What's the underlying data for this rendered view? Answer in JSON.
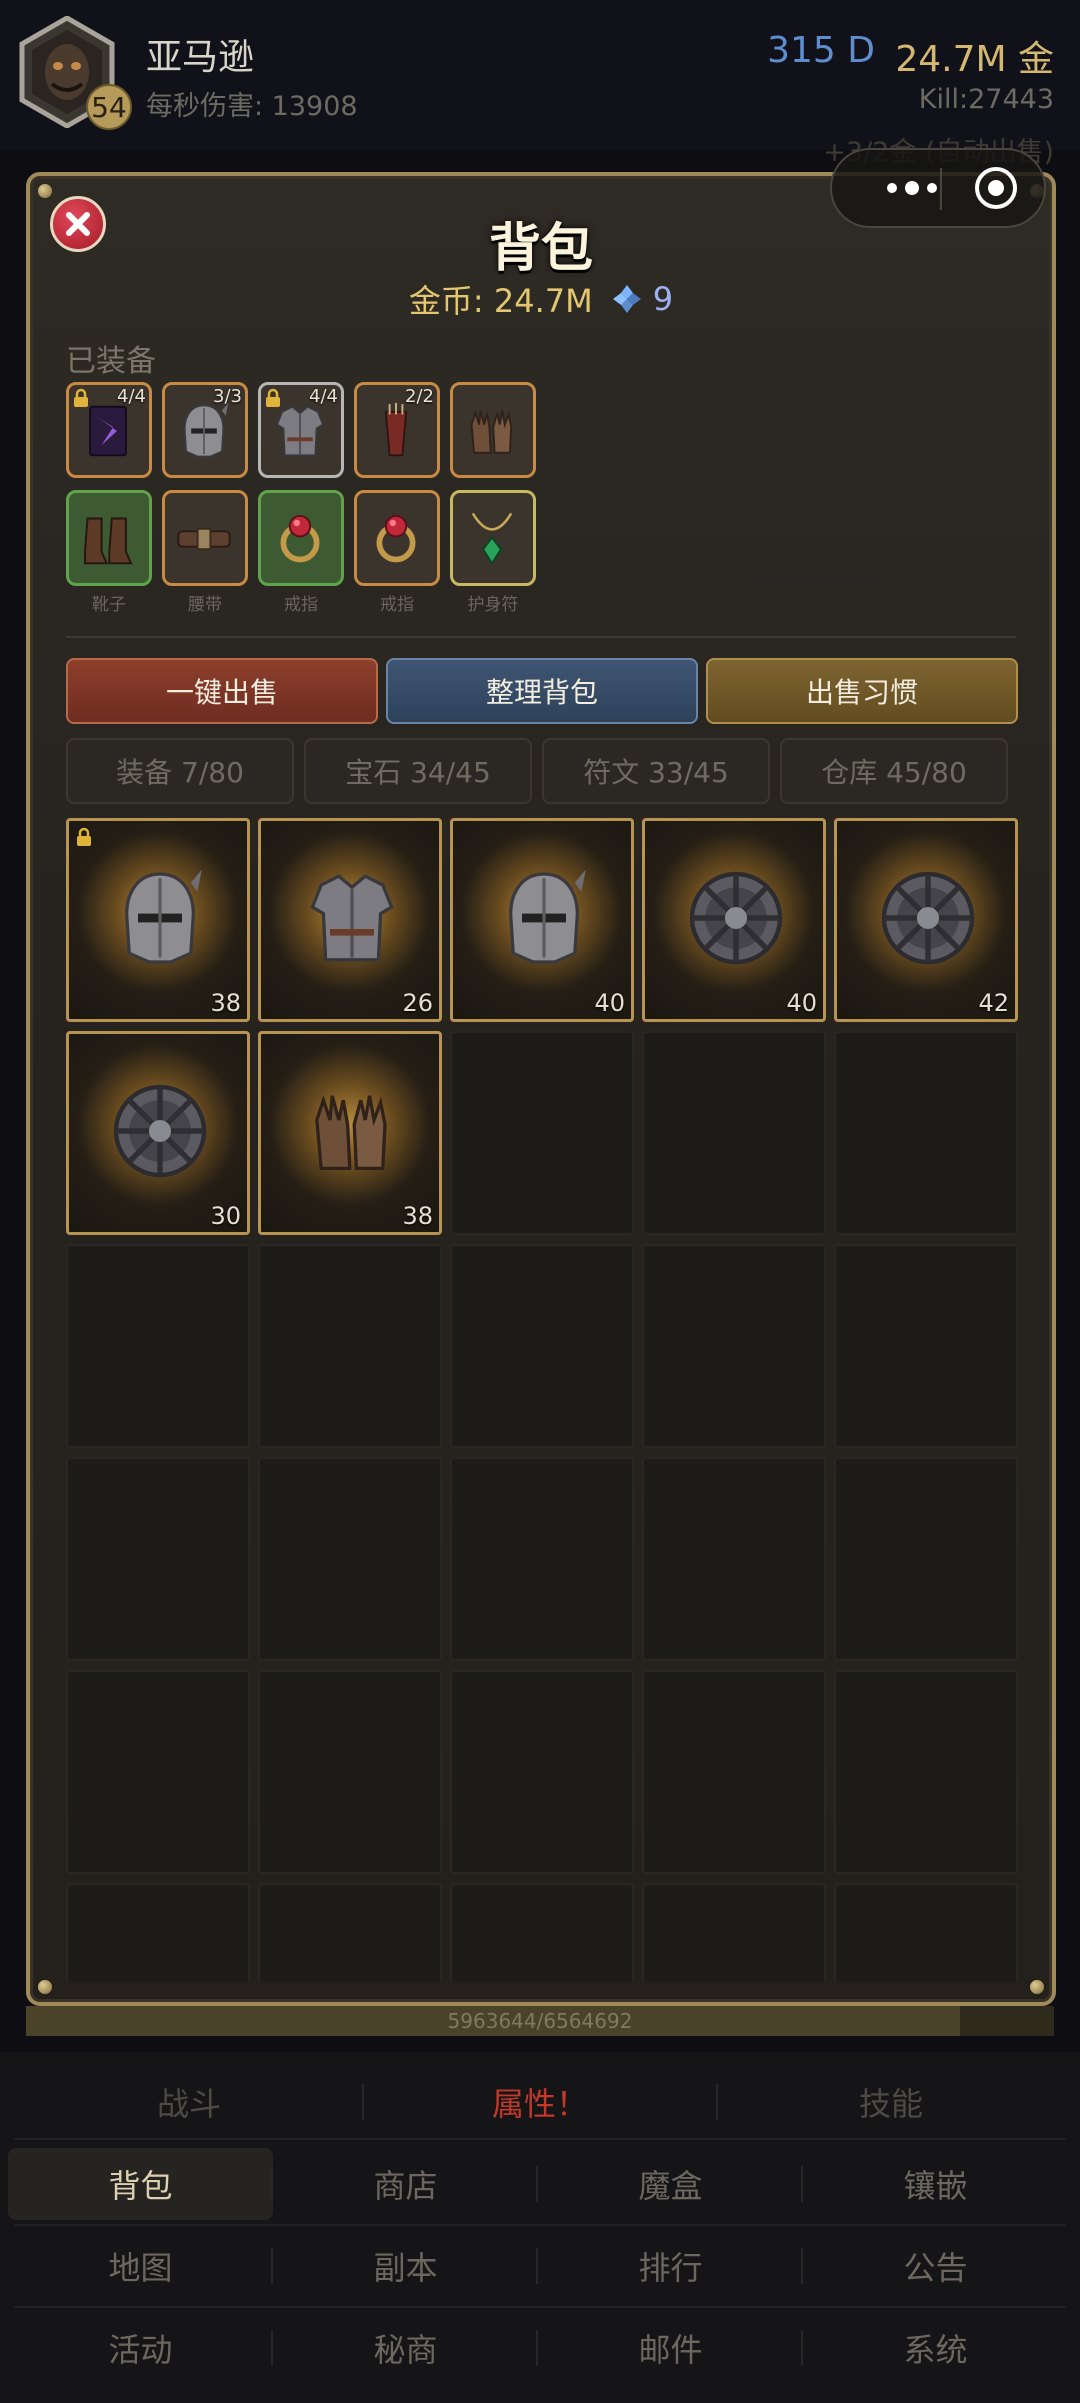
{
  "header": {
    "hero_name": "亚马逊",
    "level": "54",
    "dps": "每秒伤害: 13908",
    "diamonds": "315 D",
    "gold": "24.7M 金",
    "kills": "Kill:27443",
    "auto_sell": "+3/2金 (自动出售)"
  },
  "panel": {
    "title": "背包",
    "gold": "金币: 24.7M",
    "gems": "9",
    "equipped_label": "已装备",
    "equipped": [
      {
        "icon": "purple-tome-icon",
        "count": "4/4",
        "locked": true,
        "border": "orange",
        "label": ""
      },
      {
        "icon": "helmet-icon",
        "count": "3/3",
        "locked": false,
        "border": "orange",
        "label": ""
      },
      {
        "icon": "chest-armor-icon",
        "count": "4/4",
        "locked": true,
        "border": "grey",
        "label": ""
      },
      {
        "icon": "quiver-icon",
        "count": "2/2",
        "locked": false,
        "border": "orange",
        "label": ""
      },
      {
        "icon": "gloves-icon",
        "count": "",
        "locked": false,
        "border": "orange",
        "label": ""
      },
      {
        "icon": "boots-icon",
        "count": "",
        "locked": false,
        "border": "green",
        "label": "靴子"
      },
      {
        "icon": "belt-icon",
        "count": "",
        "locked": false,
        "border": "orange",
        "label": "腰带"
      },
      {
        "icon": "ring-icon",
        "count": "",
        "locked": false,
        "border": "green",
        "label": "戒指"
      },
      {
        "icon": "ring-icon",
        "count": "",
        "locked": false,
        "border": "orange",
        "label": "戒指"
      },
      {
        "icon": "amulet-icon",
        "count": "",
        "locked": false,
        "border": "yellow",
        "label": "护身符"
      }
    ],
    "actions": {
      "sell_all": "一键出售",
      "sort": "整理背包",
      "sell_habit": "出售习惯"
    },
    "tabs": [
      {
        "label": "装备 7/80",
        "active": true
      },
      {
        "label": "宝石 34/45",
        "active": false
      },
      {
        "label": "符文 33/45",
        "active": false
      },
      {
        "label": "仓库 45/80",
        "active": false
      }
    ],
    "items": [
      {
        "icon": "helmet-icon",
        "level": "38",
        "locked": true
      },
      {
        "icon": "chest-armor-icon",
        "level": "26",
        "locked": false
      },
      {
        "icon": "helmet-icon",
        "level": "40",
        "locked": false
      },
      {
        "icon": "shield-icon",
        "level": "40",
        "locked": false
      },
      {
        "icon": "shield-icon",
        "level": "42",
        "locked": false
      },
      {
        "icon": "shield-icon",
        "level": "30",
        "locked": false
      },
      {
        "icon": "gloves-icon",
        "level": "38",
        "locked": false
      }
    ]
  },
  "xp": {
    "text": "5963644/6564692",
    "fraction": 0.9085
  },
  "nav": {
    "top": [
      "战斗",
      "属性！",
      "技能"
    ],
    "rows": [
      [
        "背包",
        "商店",
        "魔盒",
        "镶嵌"
      ],
      [
        "地图",
        "副本",
        "排行",
        "公告"
      ],
      [
        "活动",
        "秘商",
        "邮件",
        "系统"
      ]
    ],
    "active": "背包"
  },
  "colors": {
    "accent_gold": "#e2c670",
    "border_gold": "#a08a58",
    "attr_red": "#c0392b",
    "gem_blue": "#5f8ed0"
  }
}
